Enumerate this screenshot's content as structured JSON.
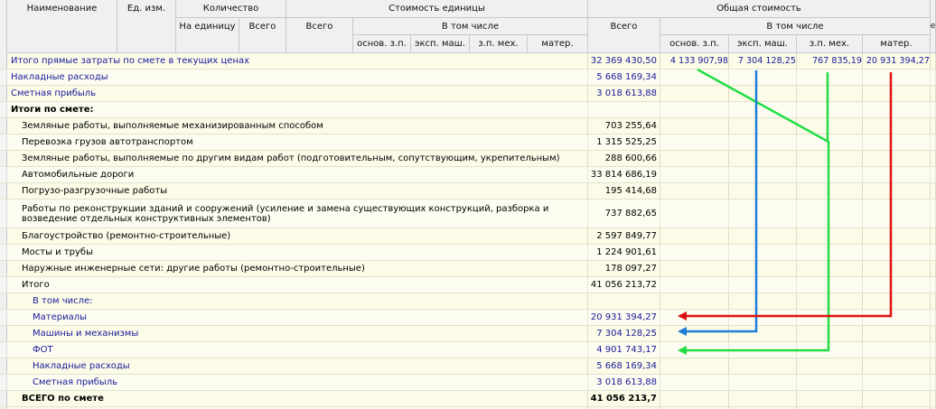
{
  "header": {
    "name": "Наименование",
    "unit": "Ед. изм.",
    "quantity": "Количество",
    "per_unit": "На единицу",
    "qty_total": "Всего",
    "unit_cost": "Стоимость единицы",
    "uc_total": "Всего",
    "uc_incl": "В том числе",
    "uc_osn": "основ. з.п.",
    "uc_eksp": "эксп. маш.",
    "uc_zpmeh": "з.п. мех.",
    "uc_mater": "матер.",
    "total_cost": "Общая стоимость",
    "tc_total": "Всего",
    "tc_incl": "В том числе",
    "tc_osn": "основ. з.п.",
    "tc_eksp": "эксп. маш.",
    "tc_zpmeh": "з.п. мех.",
    "tc_mater": "матер.",
    "edge_char": "е"
  },
  "rows": [
    {
      "name": "Итого прямые затраты по смете в текущих ценах",
      "total": "32 369 430,50",
      "osn": "4 133 907,98",
      "eksp": "7 304 128,25",
      "zpmeh": "767 835,19",
      "mater": "20 931 394,27"
    },
    {
      "name": "Накладные расходы",
      "total": "5 668 169,34"
    },
    {
      "name": "Сметная прибыль",
      "total": "3 018 613,88"
    },
    {
      "name": "Итоги по смете:"
    },
    {
      "name": "Земляные работы, выполняемые механизированным способом",
      "total": "703 255,64"
    },
    {
      "name": "Перевозка грузов автотранспортом",
      "total": "1 315 525,25"
    },
    {
      "name": "Земляные работы, выполняемые по другим видам работ (подготовительным, сопутствующим, укрепительным)",
      "total": "288 600,66"
    },
    {
      "name": "Автомобильные дороги",
      "total": "33 814 686,19"
    },
    {
      "name": "Погрузо-разгрузочные работы",
      "total": "195 414,68"
    },
    {
      "name": "Работы по реконструкции зданий и сооружений (усиление и замена существующих конструкций, разборка и возведение отдельных конструктивных элементов)",
      "total": "737 882,65"
    },
    {
      "name": "Благоустройство (ремонтно-строительные)",
      "total": "2 597 849,77"
    },
    {
      "name": "Мосты и трубы",
      "total": "1 224 901,61"
    },
    {
      "name": "Наружные инженерные сети: другие работы (ремонтно-строительные)",
      "total": "178 097,27"
    },
    {
      "name": "Итого",
      "total": "41 056 213,72"
    },
    {
      "name": "В том числе:"
    },
    {
      "name": "Материалы",
      "total": "20 931 394,27"
    },
    {
      "name": "Машины и механизмы",
      "total": "7 304 128,25"
    },
    {
      "name": "ФОТ",
      "total": "4 901 743,17"
    },
    {
      "name": "Накладные расходы",
      "total": "5 668 169,34"
    },
    {
      "name": "Сметная прибыль",
      "total": "3 018 613,88"
    },
    {
      "name": "ВСЕГО по смете",
      "total": "41 056 213,7"
    }
  ],
  "colors": {
    "arrow_green": "#22dd44",
    "arrow_blue": "#1e7fd8",
    "arrow_red": "#dd1111",
    "row_text_blue": "#1a1a9c",
    "cell_bg": "#fbfbe8"
  }
}
